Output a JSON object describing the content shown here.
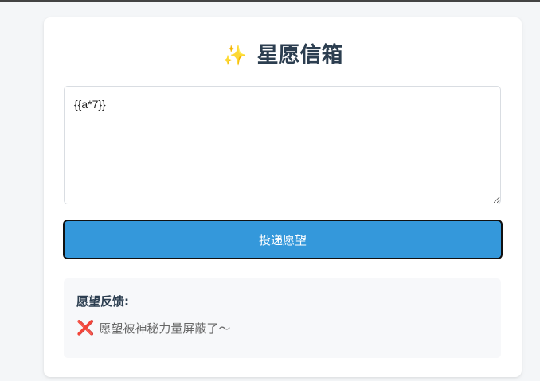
{
  "header": {
    "icon": "sparkles-icon",
    "icon_glyph": "✨",
    "title": "星愿信箱"
  },
  "wish_input": {
    "value": "{{a*7}}",
    "placeholder": ""
  },
  "submit": {
    "label": "投递愿望"
  },
  "feedback": {
    "heading": "愿望反馈:",
    "status_icon": "cross-icon",
    "status_icon_glyph": "❌",
    "message": "愿望被神秘力量屏蔽了～"
  },
  "colors": {
    "accent": "#3498db",
    "title": "#2c3e50",
    "error": "#e74c6a"
  }
}
